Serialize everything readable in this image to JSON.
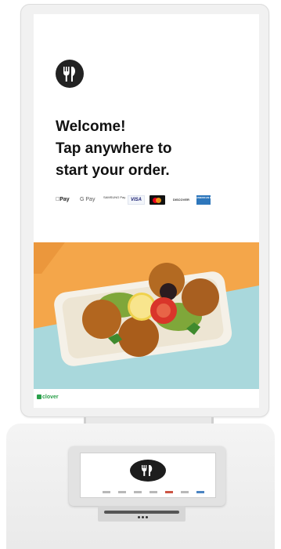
{
  "screen": {
    "welcome_lines": [
      "Welcome!",
      "Tap anywhere to",
      "start your order."
    ],
    "payments": {
      "apple_pay": "Pay",
      "google_pay": "G Pay",
      "samsung_pay": "SAMSUNG Pay",
      "visa": "VISA",
      "discover": "DISCOVER",
      "amex": "AMERICAN EXPRESS"
    },
    "brand": "clover"
  },
  "colors": {
    "accent": "#2aa04a",
    "photo_top": "#f4a64a",
    "photo_table": "#a9d8dc"
  },
  "icons": {
    "logo": "fork-knife-icon"
  }
}
